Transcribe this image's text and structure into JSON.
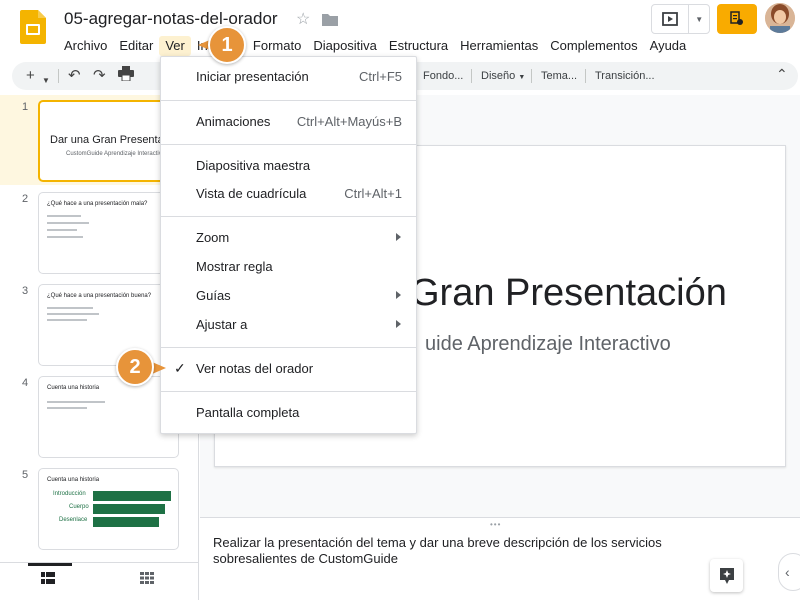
{
  "document": {
    "title": "05-agregar-notas-del-orador"
  },
  "menubar": [
    "Archivo",
    "Editar",
    "Ver",
    "Insertar",
    "Formato",
    "Diapositiva",
    "Estructura",
    "Herramientas",
    "Complementos",
    "Ayuda"
  ],
  "toolbar": {
    "background": "Fondo...",
    "layout": "Diseño",
    "theme": "Tema...",
    "transition": "Transición..."
  },
  "view_menu": {
    "items": [
      {
        "label": "Iniciar presentación",
        "shortcut": "Ctrl+F5"
      },
      {
        "label": "Animaciones",
        "shortcut": "Ctrl+Alt+Mayús+B"
      },
      {
        "label": "Diapositiva maestra",
        "shortcut": ""
      },
      {
        "label": "Vista de cuadrícula",
        "shortcut": "Ctrl+Alt+1"
      },
      {
        "label": "Zoom",
        "shortcut": ""
      },
      {
        "label": "Mostrar regla",
        "shortcut": ""
      },
      {
        "label": "Guías",
        "shortcut": ""
      },
      {
        "label": "Ajustar a",
        "shortcut": ""
      },
      {
        "label": "Ver notas del orador",
        "shortcut": ""
      },
      {
        "label": "Pantalla completa",
        "shortcut": ""
      }
    ]
  },
  "slides": [
    {
      "number": "1",
      "title": "Dar una Gran Presentación",
      "subtitle": "CustomGuide Aprendizaje Interactivo"
    },
    {
      "number": "2",
      "title": "¿Qué hace a una presentación mala?"
    },
    {
      "number": "3",
      "title": "¿Qué hace a una presentación buena?"
    },
    {
      "number": "4",
      "title": "Cuenta una historia"
    },
    {
      "number": "5",
      "title": "Cuenta una historia",
      "bars": [
        "Introducción",
        "Cuerpo",
        "Desenlace"
      ]
    }
  ],
  "main_slide": {
    "title": "Gran Presentación",
    "subtitle": "uide Aprendizaje Interactivo"
  },
  "speaker_notes": "Realizar la presentación del tema y dar una breve descripción de los servicios sobresalientes de CustomGuide",
  "callouts": [
    "1",
    "2"
  ],
  "colors": {
    "accent": "#f4b400",
    "callout": "#e7943a",
    "share": "#f9ab00",
    "thumb_bar": "#1e7145"
  }
}
